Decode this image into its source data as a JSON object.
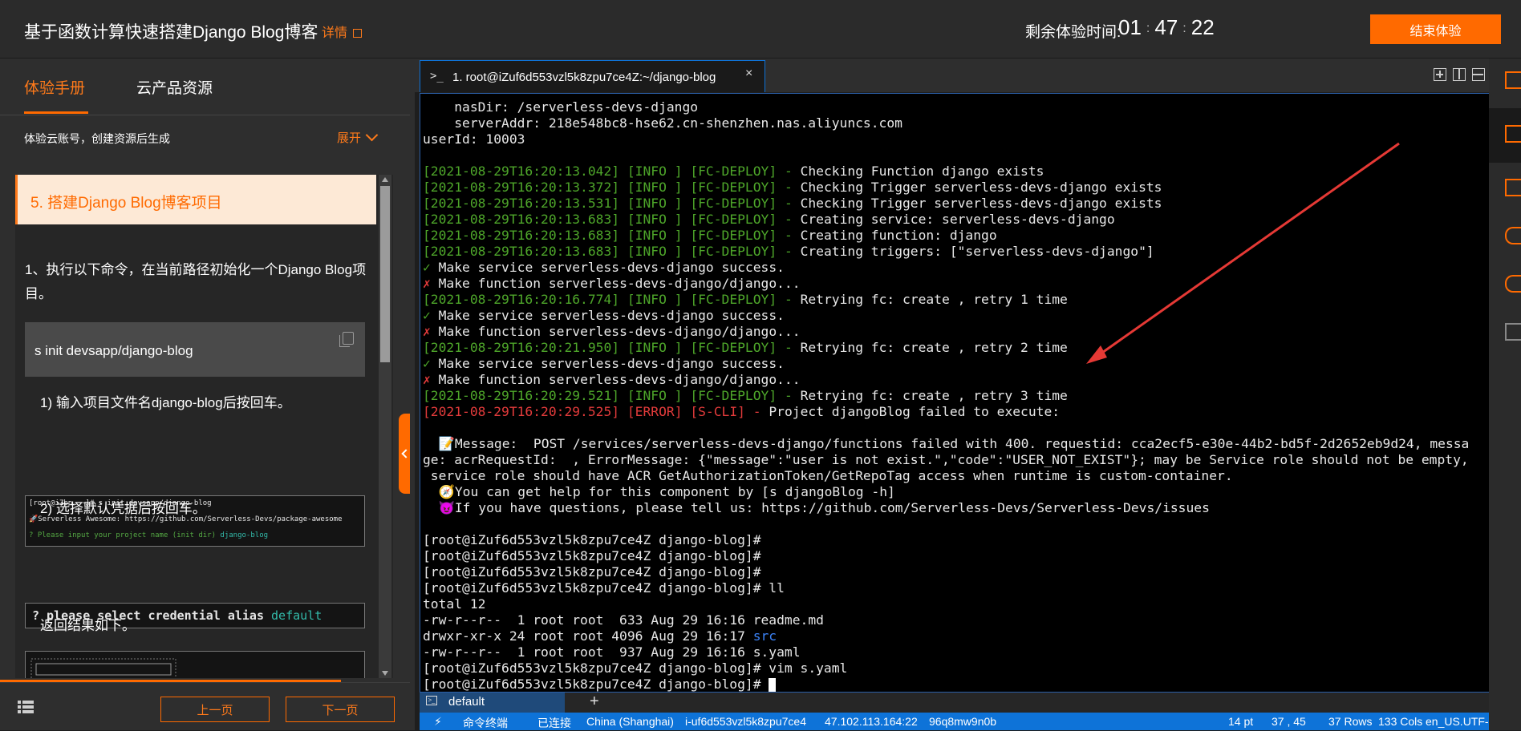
{
  "header": {
    "title": "基于函数计算快速搭建Django Blog博客",
    "details_label": "详情",
    "timer_label": "剩余体验时间:",
    "timer_h": "01",
    "timer_m": "47",
    "timer_s": "22",
    "end_button": "结束体验",
    "accent_color": "#ff6a00"
  },
  "left": {
    "tabs": [
      "体验手册",
      "云产品资源"
    ],
    "account_text": "体验云账号，创建资源后生成",
    "expand_label": "展开",
    "step_title": "5. 搭建Django Blog博客项目",
    "step1_text": "1、执行以下命令，在当前路径初始化一个Django Blog项目。",
    "command": "s init devsapp/django-blog",
    "sub1": "1) 输入项目文件名django-blog后按回车。",
    "shot1_line1": "[root@iZbp… ~]# s init devsapp/django-blog",
    "shot1_line2": "🚀Serverless Awesome: https://github.com/Serverless-Devs/package-awesome",
    "shot1_line3_a": "? Please input your project name (init dir) ",
    "shot1_line3_b": "django-blog",
    "sub2": "2) 选择默认凭据后按回车。",
    "shot2_a": "? please select credential alias ",
    "shot2_b": "default",
    "sub3": "返回结果如下。",
    "prev_button": "上一页",
    "next_button": "下一页"
  },
  "terminal": {
    "tab_prompt": ">_",
    "tab_label": "1. root@iZuf6d553vzl5k8zpu7ce4Z:~/django-blog",
    "tab_close": "×",
    "lines_plain_top": [
      "    nasDir: /serverless-devs-django",
      "    serverAddr: 218e548bc8-hse62.cn-shenzhen.nas.aliyuncs.com",
      "userId: 10003"
    ],
    "deploy_logs": [
      {
        "ts": "[2021-08-29T16:20:13.042]",
        "lvl": "[INFO ]",
        "tag": "[FC-DEPLOY]",
        "msg": "Checking Function django exists"
      },
      {
        "ts": "[2021-08-29T16:20:13.372]",
        "lvl": "[INFO ]",
        "tag": "[FC-DEPLOY]",
        "msg": "Checking Trigger serverless-devs-django exists"
      },
      {
        "ts": "[2021-08-29T16:20:13.531]",
        "lvl": "[INFO ]",
        "tag": "[FC-DEPLOY]",
        "msg": "Checking Trigger serverless-devs-django exists"
      },
      {
        "ts": "[2021-08-29T16:20:13.683]",
        "lvl": "[INFO ]",
        "tag": "[FC-DEPLOY]",
        "msg": "Creating service: serverless-devs-django"
      },
      {
        "ts": "[2021-08-29T16:20:13.683]",
        "lvl": "[INFO ]",
        "tag": "[FC-DEPLOY]",
        "msg": "Creating function: django"
      },
      {
        "ts": "[2021-08-29T16:20:13.683]",
        "lvl": "[INFO ]",
        "tag": "[FC-DEPLOY]",
        "msg": "Creating triggers: [\"serverless-devs-django\"]"
      }
    ],
    "ok_service": "Make service serverless-devs-django success.",
    "fail_function": "Make function serverless-devs-django/django...",
    "retries": [
      {
        "ts": "[2021-08-29T16:20:16.774]",
        "lvl": "[INFO ]",
        "tag": "[FC-DEPLOY]",
        "msg": "Retrying fc: create , retry 1 time"
      },
      {
        "ts": "[2021-08-29T16:20:21.950]",
        "lvl": "[INFO ]",
        "tag": "[FC-DEPLOY]",
        "msg": "Retrying fc: create , retry 2 time"
      },
      {
        "ts": "[2021-08-29T16:20:29.521]",
        "lvl": "[INFO ]",
        "tag": "[FC-DEPLOY]",
        "msg": "Retrying fc: create , retry 3 time"
      }
    ],
    "error": {
      "ts": "[2021-08-29T16:20:29.525]",
      "lvl": "[ERROR]",
      "tag": "[S-CLI]",
      "msg": "Project djangoBlog failed to execute:"
    },
    "message_lines": [
      "  📝Message:  POST /services/serverless-devs-django/functions failed with 400. requestid: cca2ecf5-e30e-44b2-bd5f-2d2652eb9d24, messa",
      "ge: acrRequestId:  , ErrorMessage: {\"message\":\"user is not exist.\",\"code\":\"USER_NOT_EXIST\"}; may be Service role should not be empty,",
      " service role should have ACR GetAuthorizationToken/GetRepoTag access when runtime is custom-container.",
      "  🧭You can get help for this component by [s djangoBlog -h]",
      "  😈If you have questions, please tell us: https://github.com/Serverless-Devs/Serverless-Devs/issues"
    ],
    "prompt": "[root@iZuf6d553vzl5k8zpu7ce4Z django-blog]#",
    "ll_cmd": " ll",
    "total": "total 12",
    "ls_rows": [
      {
        "a": "-rw-r--r--  1 root root  633 Aug 29 16:16 ",
        "name": "readme.md",
        "dir": false
      },
      {
        "a": "drwxr-xr-x 24 root root 4096 Aug 29 16:17 ",
        "name": "src",
        "dir": true
      },
      {
        "a": "-rw-r--r--  1 root root  937 Aug 29 16:16 ",
        "name": "s.yaml",
        "dir": false
      }
    ],
    "vim_cmd": " vim s.yaml",
    "session_tab": "default",
    "plus": "+"
  },
  "status_bar": {
    "items": [
      "命令终端",
      "已连接",
      "China (Shanghai)",
      "i-uf6d553vzl5k8zpu7ce4",
      "47.102.113.164:22",
      "96q8mw9n0b",
      "14 pt",
      "37 , 45",
      "37 Rows",
      "133 Cols",
      "en_US.UTF-8"
    ]
  }
}
